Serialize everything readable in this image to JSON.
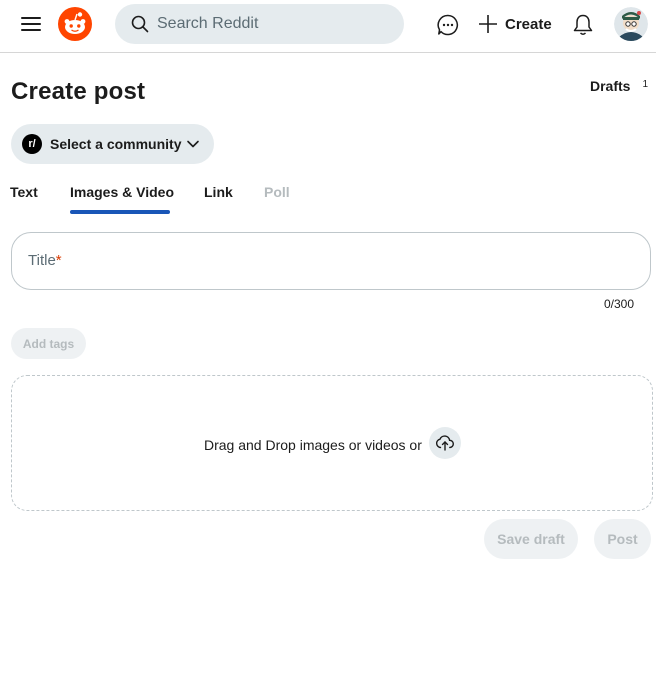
{
  "header": {
    "search_placeholder": "Search Reddit",
    "create_label": "Create",
    "brand_color": "#ff4500"
  },
  "page": {
    "title": "Create post",
    "drafts_label": "Drafts",
    "drafts_count": "1"
  },
  "community_selector": {
    "icon_text": "r/",
    "label": "Select a community"
  },
  "tabs": [
    {
      "label": "Text",
      "selected": false,
      "disabled": false
    },
    {
      "label": "Images & Video",
      "selected": true,
      "disabled": false
    },
    {
      "label": "Link",
      "selected": false,
      "disabled": false
    },
    {
      "label": "Poll",
      "selected": false,
      "disabled": true
    }
  ],
  "title_field": {
    "placeholder": "Title",
    "required_mark": "*",
    "char_count": "0/300"
  },
  "tags": {
    "label": "Add tags"
  },
  "dropzone": {
    "text": "Drag and Drop images or videos or"
  },
  "actions": {
    "save_draft": "Save draft",
    "post": "Post"
  },
  "colors": {
    "accent": "#1956b7",
    "required": "#d93a00",
    "surface": "#e5ebee"
  }
}
